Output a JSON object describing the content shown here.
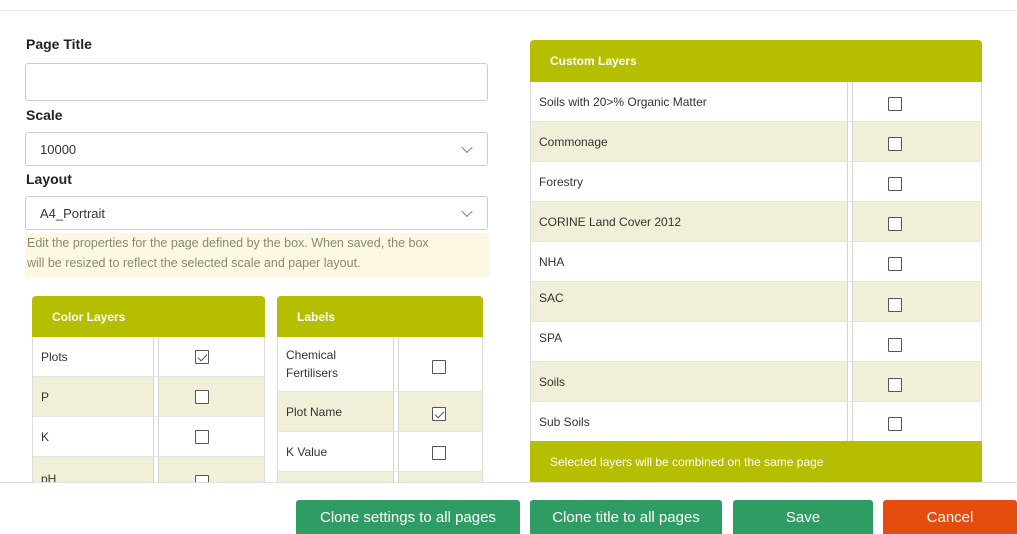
{
  "form": {
    "page_title_label": "Page Title",
    "page_title_value": "",
    "scale_label": "Scale",
    "scale_value": "10000",
    "layout_label": "Layout",
    "layout_value": "A4_Portrait",
    "hint_line1": "Edit the properties for the page defined by the box. When saved, the box",
    "hint_line2": "will be resized to reflect the selected scale and paper layout."
  },
  "color_layers": {
    "title": "Color Layers",
    "rows": [
      {
        "label": "Plots",
        "checked": true
      },
      {
        "label": "P",
        "checked": false
      },
      {
        "label": "K",
        "checked": false
      },
      {
        "label": "pH",
        "checked": false
      }
    ]
  },
  "labels": {
    "title": "Labels",
    "rows": [
      {
        "label": "Chemical Fertilisers",
        "checked": false
      },
      {
        "label": "Plot Name",
        "checked": true
      },
      {
        "label": "K Value",
        "checked": false
      }
    ]
  },
  "custom_layers": {
    "title": "Custom Layers",
    "rows": [
      {
        "label": "Soils with 20>% Organic Matter",
        "checked": false
      },
      {
        "label": "Commonage",
        "checked": false
      },
      {
        "label": "Forestry",
        "checked": false
      },
      {
        "label": "CORINE Land Cover 2012",
        "checked": false
      },
      {
        "label": "NHA",
        "checked": false
      },
      {
        "label": "SAC",
        "checked": false
      },
      {
        "label": "SPA",
        "checked": false
      },
      {
        "label": "Soils",
        "checked": false
      },
      {
        "label": "Sub Soils",
        "checked": false
      }
    ],
    "footer": "Selected layers will be combined on the same page"
  },
  "buttons": {
    "clone_settings": "Clone settings to all pages",
    "clone_title": "Clone title to all pages",
    "save": "Save",
    "cancel": "Cancel"
  },
  "colors": {
    "accent": "#b5be00",
    "row_alt": "#f1efd8",
    "button_green": "#2e9c63",
    "button_red": "#e44d0d",
    "hint_bg": "#fcf8e3"
  }
}
